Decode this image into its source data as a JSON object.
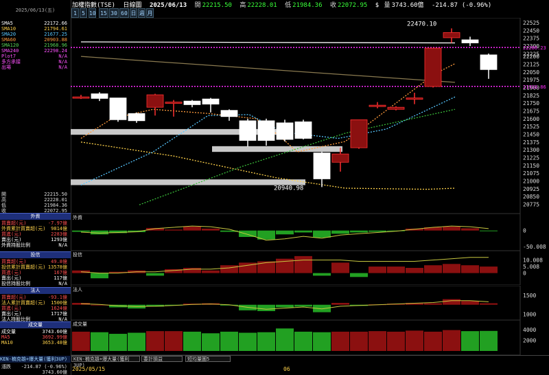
{
  "window": {
    "title": "加權指數(TSE)",
    "chart_type": "日線圖",
    "date": "2025/06/13",
    "open_label": "開",
    "open": "22215.50",
    "high_label": "高",
    "high": "22228.01",
    "low_label": "低",
    "low": "21984.36",
    "close_label": "收",
    "close": "22072.95",
    "vol_unit": "$",
    "volume_label": "量",
    "volume": "3743.60億",
    "change": "-214.87",
    "change_pct": "(-0.96%)"
  },
  "timeframes": [
    "1",
    "5",
    "10",
    "15",
    "30",
    "60",
    "日",
    "週",
    "月"
  ],
  "left_panel": {
    "date": "2025/06/13(五)",
    "ma_rows": [
      {
        "name": "SMA5",
        "value": "22172.66",
        "color": "#ffffff"
      },
      {
        "name": "SMA10",
        "value": "21794.61",
        "color": "#ffd24a"
      },
      {
        "name": "SMA20",
        "value": "21677.25",
        "color": "#57c7ff"
      },
      {
        "name": "SMA60",
        "value": "20903.88",
        "color": "#ff9b3d"
      },
      {
        "name": "SMA120",
        "value": "21968.96",
        "color": "#58d858"
      },
      {
        "name": "SMA240",
        "value": "22298.24",
        "color": "#ff52ff"
      },
      {
        "name": "Plot7",
        "value": "N/A",
        "color": "#ff52ff"
      },
      {
        "name": "多方承接",
        "value": "N/A",
        "color": "#ff52ff"
      },
      {
        "name": "出場",
        "value": "N/A",
        "color": "#ff52ff"
      }
    ],
    "ohlc_rows": [
      {
        "name": "開",
        "value": "22215.50"
      },
      {
        "name": "高",
        "value": "22228.01"
      },
      {
        "name": "低",
        "value": "21984.36"
      },
      {
        "name": "收",
        "value": "22072.95"
      }
    ],
    "foreign": {
      "title": "外資",
      "rows": [
        {
          "name": "買賣超(元)",
          "value": "-7.97億",
          "color": "#ff5050"
        },
        {
          "name": "外資累計買賣超(元)",
          "value": "9814億",
          "color": "#ffd24a"
        },
        {
          "name": "買進(元)",
          "value": "2283億",
          "color": "#ff5050"
        },
        {
          "name": "賣出(元)",
          "value": "1293億",
          "color": "#ffffff"
        },
        {
          "name": "外資持股比例",
          "value": "N/A",
          "color": "#ffffff"
        }
      ]
    },
    "trust": {
      "title": "投信",
      "rows": [
        {
          "name": "買賣超(元)",
          "value": "49.8億",
          "color": "#ff5050"
        },
        {
          "name": "投信累計買賣超(元)",
          "value": "13578億",
          "color": "#ffd24a"
        },
        {
          "name": "買進(元)",
          "value": "167億",
          "color": "#ff5050"
        },
        {
          "name": "賣出(元)",
          "value": "117億",
          "color": "#ffffff"
        },
        {
          "name": "投信持股比例",
          "value": "N/A",
          "color": "#ffffff"
        }
      ]
    },
    "legal": {
      "title": "法人",
      "rows": [
        {
          "name": "買賣超(元)",
          "value": "-93.1億",
          "color": "#ff5050"
        },
        {
          "name": "法人累計買賣超(元)",
          "value": "1500億",
          "color": "#ffd24a"
        },
        {
          "name": "買進(元)",
          "value": "1624億",
          "color": "#ff5050"
        },
        {
          "name": "賣出(元)",
          "value": "1717億",
          "color": "#ffffff"
        },
        {
          "name": "法人持股比例",
          "value": "N/A",
          "color": "#ffffff"
        }
      ]
    },
    "volume": {
      "title": "成交量",
      "rows": [
        {
          "name": "成交量",
          "value": "3743.60億",
          "color": "#ffffff"
        },
        {
          "name": "MA5",
          "value": "3692.99億",
          "color": "#ff5050"
        },
        {
          "name": "MA10",
          "value": "3653.48億",
          "color": "#ffd24a"
        }
      ]
    },
    "footer_label": "漲跌",
    "footer_change": "-214.87 (-0.96%)",
    "footer_volume": "3743.60億"
  },
  "bottom_bar": {
    "indicator": "KEN-楠克雄+爆大量(獲利3UP)",
    "dropdown1": "KEN-楠克雄+爆大量(獲利3UP)",
    "dropdown2": "委計損益",
    "dropdown3": "短均量圖5"
  },
  "x_axis": {
    "labels": [
      "2025/05/15",
      "06"
    ]
  },
  "panels": {
    "foreign_label": "外資",
    "trust_label": "投信",
    "legal_label": "法人",
    "volume_label": "成交量"
  },
  "price_axis": {
    "ticks": [
      "22525",
      "22450",
      "22375",
      "22300",
      "22225",
      "22200",
      "22125",
      "22050",
      "21975",
      "21900",
      "21825",
      "21750",
      "21675",
      "21600",
      "21525",
      "21450",
      "21375",
      "21300",
      "21225",
      "21150",
      "21075",
      "21000",
      "20925",
      "20850",
      "20775"
    ],
    "marker_high": "22286.23",
    "marker_low": "21910.86",
    "annot_high": "22470.10",
    "annot_low": "20940.98"
  },
  "foreign_axis": {
    "ticks": [
      "0",
      "-50.008"
    ]
  },
  "trust_axis": {
    "ticks": [
      "10.008",
      "5.008",
      "0"
    ]
  },
  "legal_axis": {
    "ticks": [
      "1500",
      "1000"
    ]
  },
  "volume_axis": {
    "ticks": [
      "4000",
      "2000"
    ]
  },
  "colors": {
    "up": "#8b1010",
    "up_border": "#ff3030",
    "down": "#ffffff",
    "neutral": "#ffffff",
    "vol_up": "#8b1010",
    "vol_down": "#22a022",
    "zone": "#c8c8c8",
    "magenta": "#ff2bff"
  },
  "chart_data": {
    "type": "candlestick",
    "candles": [
      {
        "o": 21810,
        "h": 21830,
        "l": 21790,
        "c": 21810
      },
      {
        "o": 21840,
        "h": 21855,
        "l": 21770,
        "c": 21795
      },
      {
        "o": 21800,
        "h": 21800,
        "l": 21570,
        "c": 21590
      },
      {
        "o": 21650,
        "h": 21660,
        "l": 21560,
        "c": 21580
      },
      {
        "o": 21710,
        "h": 21840,
        "l": 21630,
        "c": 21830
      },
      {
        "o": 21760,
        "h": 21780,
        "l": 21620,
        "c": 21760
      },
      {
        "o": 21770,
        "h": 21780,
        "l": 21710,
        "c": 21735
      },
      {
        "o": 21790,
        "h": 21800,
        "l": 21660,
        "c": 21740
      },
      {
        "o": 21680,
        "h": 21690,
        "l": 21580,
        "c": 21620
      },
      {
        "o": 21580,
        "h": 21600,
        "l": 21330,
        "c": 21390
      },
      {
        "o": 21580,
        "h": 21600,
        "l": 21340,
        "c": 21390
      },
      {
        "o": 21560,
        "h": 21590,
        "l": 21380,
        "c": 21400
      },
      {
        "o": 21570,
        "h": 21590,
        "l": 21400,
        "c": 21410
      },
      {
        "o": 21270,
        "h": 21280,
        "l": 20941,
        "c": 21020
      },
      {
        "o": 21180,
        "h": 21320,
        "l": 21090,
        "c": 21260
      },
      {
        "o": 21320,
        "h": 21590,
        "l": 21310,
        "c": 21590
      },
      {
        "o": 21720,
        "h": 21760,
        "l": 21700,
        "c": 21730
      },
      {
        "o": 21690,
        "h": 21720,
        "l": 21680,
        "c": 21710
      },
      {
        "o": 21790,
        "h": 21850,
        "l": 21740,
        "c": 21800
      },
      {
        "o": 21910,
        "h": 22280,
        "l": 21900,
        "c": 22280
      },
      {
        "o": 22380,
        "h": 22470,
        "l": 22330,
        "c": 22430
      },
      {
        "o": 22360,
        "h": 22390,
        "l": 22300,
        "c": 22330
      },
      {
        "o": 22215,
        "h": 22228,
        "l": 21984,
        "c": 22073
      }
    ],
    "foreign": [
      -4,
      -12,
      -8,
      -5,
      8,
      3,
      12,
      6,
      -4,
      -20,
      -28,
      -12,
      -6,
      -22,
      -10,
      -6,
      -4,
      -2,
      6,
      10,
      12,
      7,
      -2
    ],
    "trust": [
      2,
      -4,
      1,
      2,
      -2,
      3,
      4,
      2,
      6,
      8,
      9,
      11,
      13,
      -2,
      8,
      -3,
      5,
      5,
      4,
      6,
      7,
      6,
      5
    ],
    "legal": [
      1300,
      1250,
      1180,
      1150,
      1200,
      1230,
      1280,
      1290,
      1230,
      1100,
      1080,
      1180,
      1200,
      1050,
      1300,
      1220,
      1260,
      1280,
      1300,
      1290,
      1400,
      1350,
      1290
    ],
    "volume": [
      3600,
      3500,
      3200,
      3400,
      3700,
      3700,
      3600,
      3300,
      3600,
      3400,
      3500,
      4200,
      3600,
      3500,
      3600,
      3600,
      3700,
      3600,
      3800,
      3600,
      3900,
      3700,
      3744
    ]
  }
}
